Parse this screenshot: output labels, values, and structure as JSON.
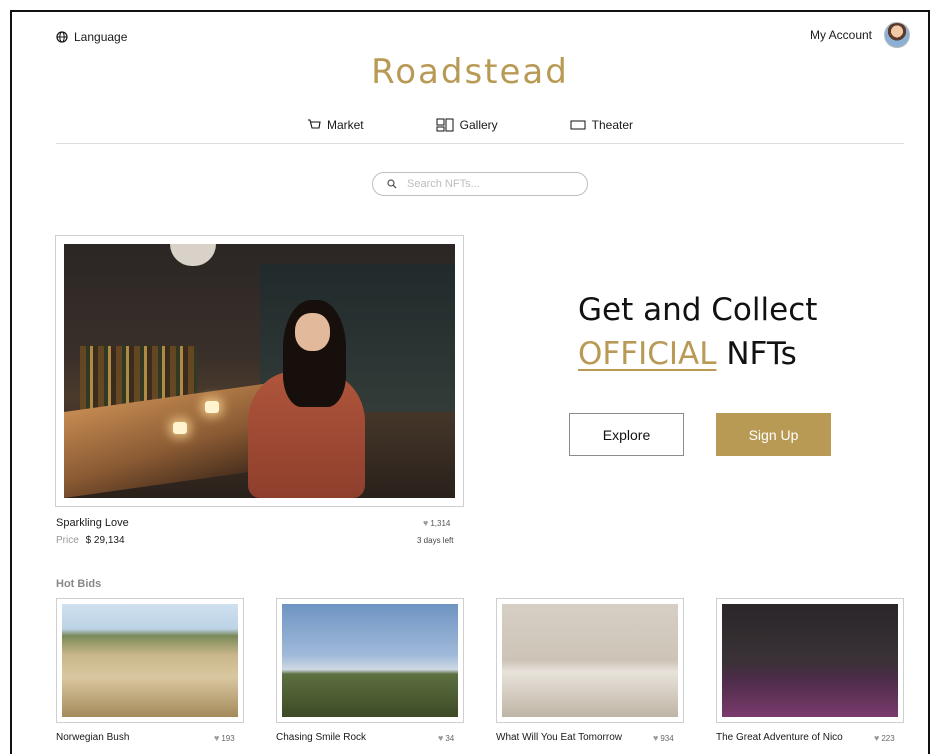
{
  "topbar": {
    "language_label": "Language",
    "account_label": "My Account"
  },
  "brand": {
    "name": "Roadstead",
    "color": "#b89a55"
  },
  "nav": {
    "items": [
      {
        "label": "Market",
        "icon": "cart-icon"
      },
      {
        "label": "Gallery",
        "icon": "gallery-icon"
      },
      {
        "label": "Theater",
        "icon": "screen-icon"
      }
    ]
  },
  "search": {
    "placeholder": "Search NFTs..."
  },
  "featured": {
    "title": "Sparkling Love",
    "price_label": "Price",
    "price": "$ 29,134",
    "likes": "1,314",
    "time_left": "3 days left"
  },
  "hero": {
    "line1": "Get and Collect",
    "accent": "OFFICIAL",
    "line2_rest": " NFTs",
    "explore_label": "Explore",
    "signup_label": "Sign Up"
  },
  "hot_bids": {
    "title": "Hot Bids",
    "items": [
      {
        "title": "Norwegian Bush",
        "likes": "193"
      },
      {
        "title": "Chasing Smile Rock",
        "likes": "34"
      },
      {
        "title": "What Will You Eat Tomorrow",
        "likes": "934"
      },
      {
        "title": "The Great Adventure of Nico",
        "likes": "223"
      }
    ]
  }
}
